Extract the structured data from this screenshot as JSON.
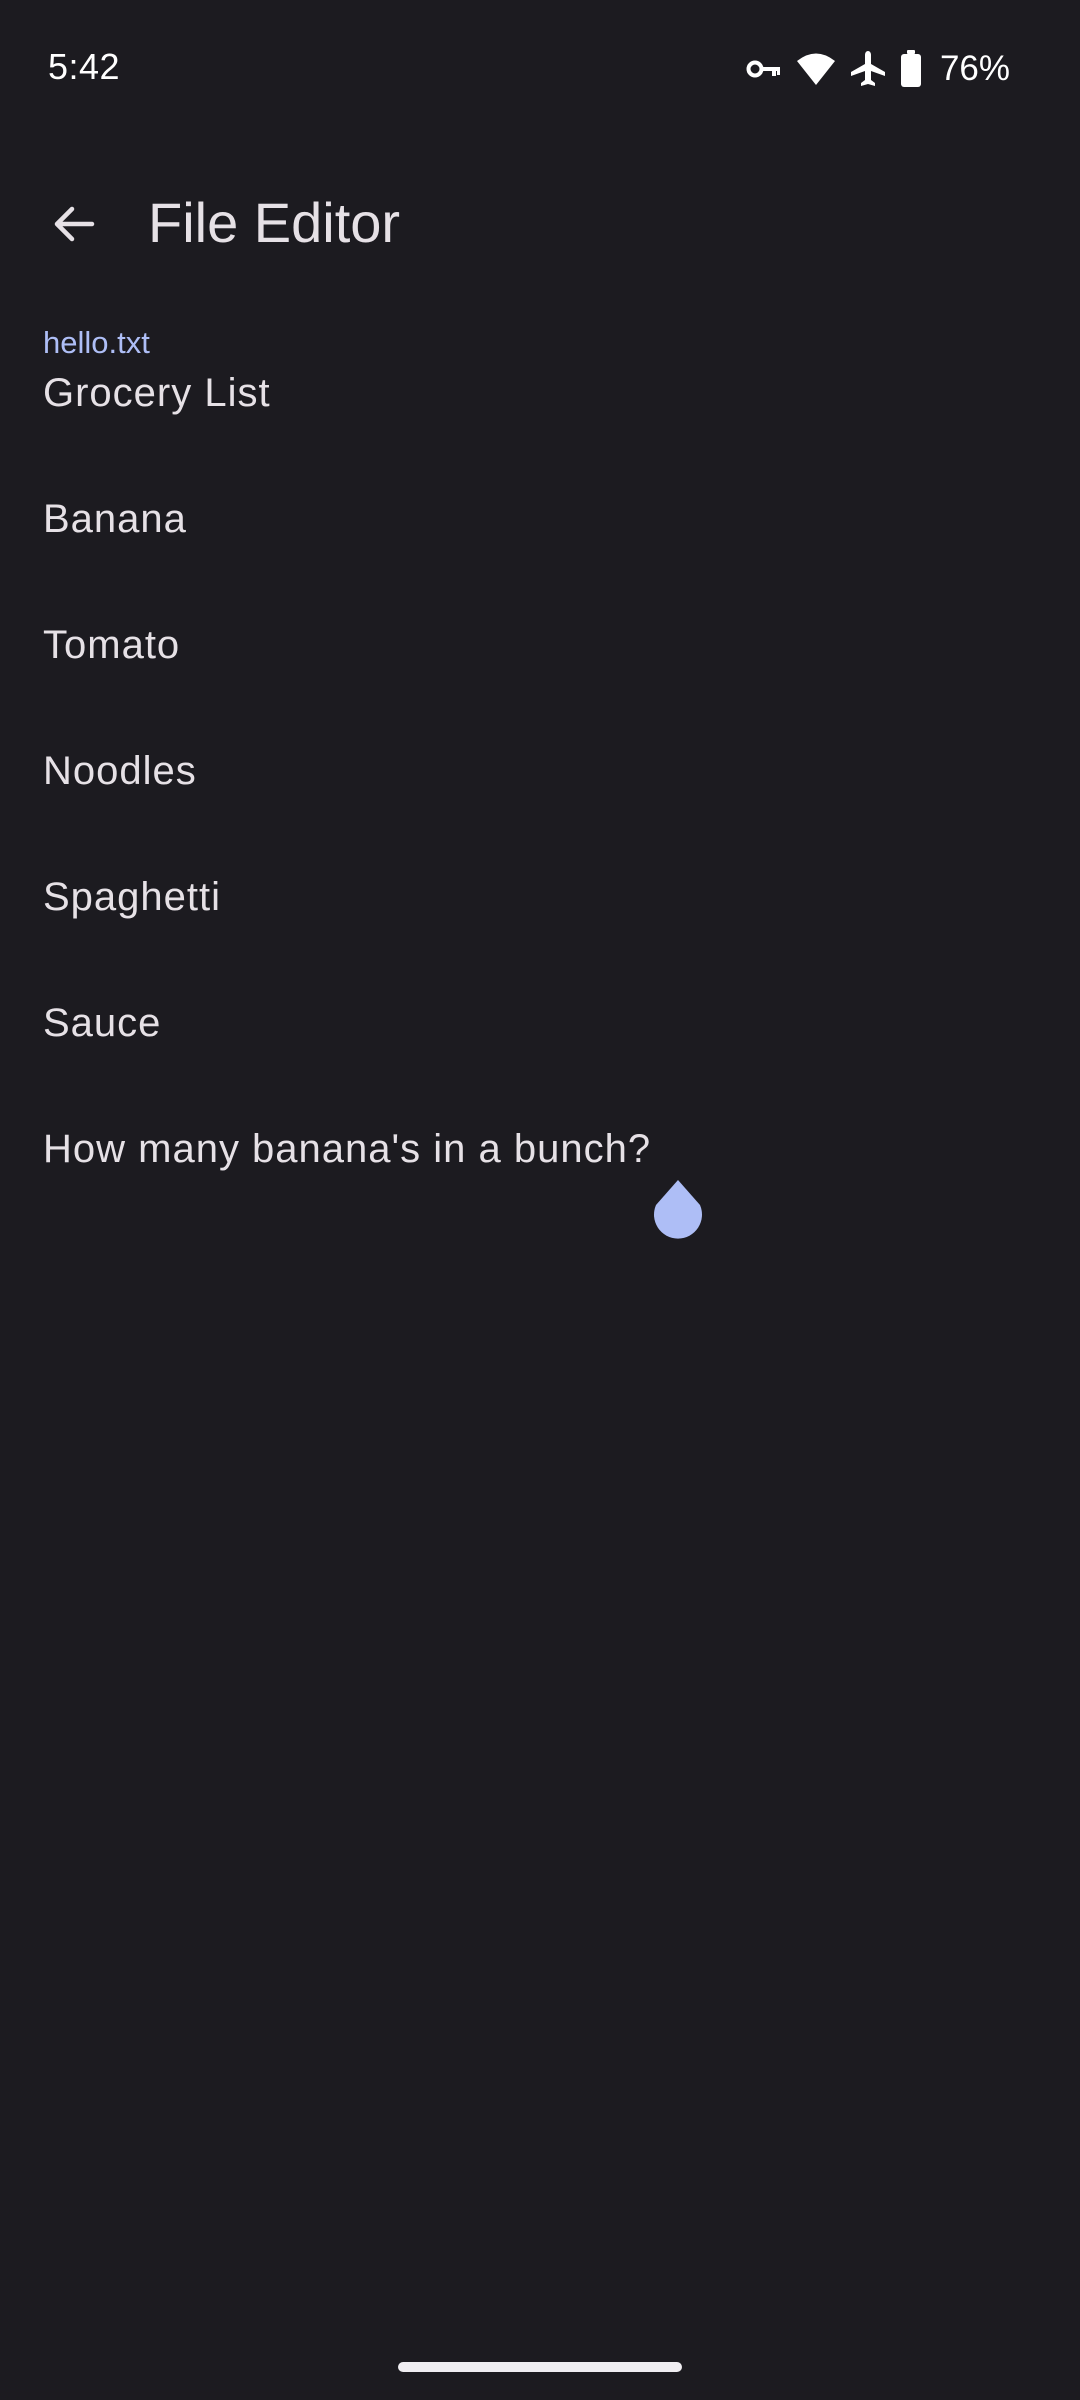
{
  "status_bar": {
    "time": "5:42",
    "battery_percent": "76%",
    "icons": [
      "vpn-key-icon",
      "wifi-icon",
      "airplane-icon",
      "battery-icon"
    ]
  },
  "app_bar": {
    "back_icon": "arrow-back-icon",
    "title": "File Editor"
  },
  "editor": {
    "file_name": "hello.txt",
    "lines": [
      "Grocery List",
      "Banana",
      "Tomato",
      "Noodles",
      "Spaghetti",
      "Sauce",
      "How many banana's in a bunch?"
    ]
  },
  "colors": {
    "background": "#1c1b20",
    "accent": "#aebef6",
    "text": "#e6e1e6"
  }
}
